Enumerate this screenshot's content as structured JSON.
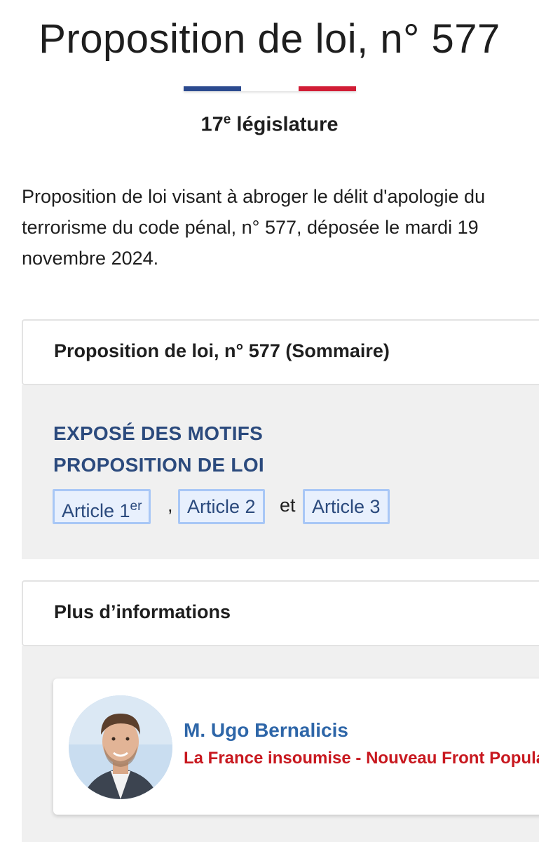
{
  "header": {
    "title": "Proposition de loi, n° 577",
    "legislature_number": "17",
    "legislature_sup": "e",
    "legislature_label": "législature",
    "tricolor": [
      "#2b4a8f",
      "#ffffff",
      "#d11d35"
    ]
  },
  "description": "Proposition de loi visant à abroger le délit d'apologie du terrorisme du code pénal, n° 577, déposée le mardi 19 novembre 2024.",
  "summary": {
    "header": "Proposition de loi, n° 577 (Sommaire)",
    "links": [
      "EXPOSÉ DES MOTIFS",
      "PROPOSITION DE LOI"
    ],
    "articles": [
      {
        "label": "Article 1",
        "sup": "er"
      },
      {
        "label": "Article 2"
      },
      {
        "label": "Article 3"
      }
    ],
    "separators": [
      ",",
      "et"
    ]
  },
  "more_info": {
    "header": "Plus d’informations",
    "deputy": {
      "name": "M. Ugo Bernalicis",
      "group": "La France insoumise - Nouveau Front Populaire"
    }
  },
  "colors": {
    "link": "#2b4a7d",
    "article_bg": "#e8f0fd",
    "article_border": "#a8c7f6",
    "deputy_name": "#2e66a8",
    "deputy_group": "#c8181f"
  }
}
